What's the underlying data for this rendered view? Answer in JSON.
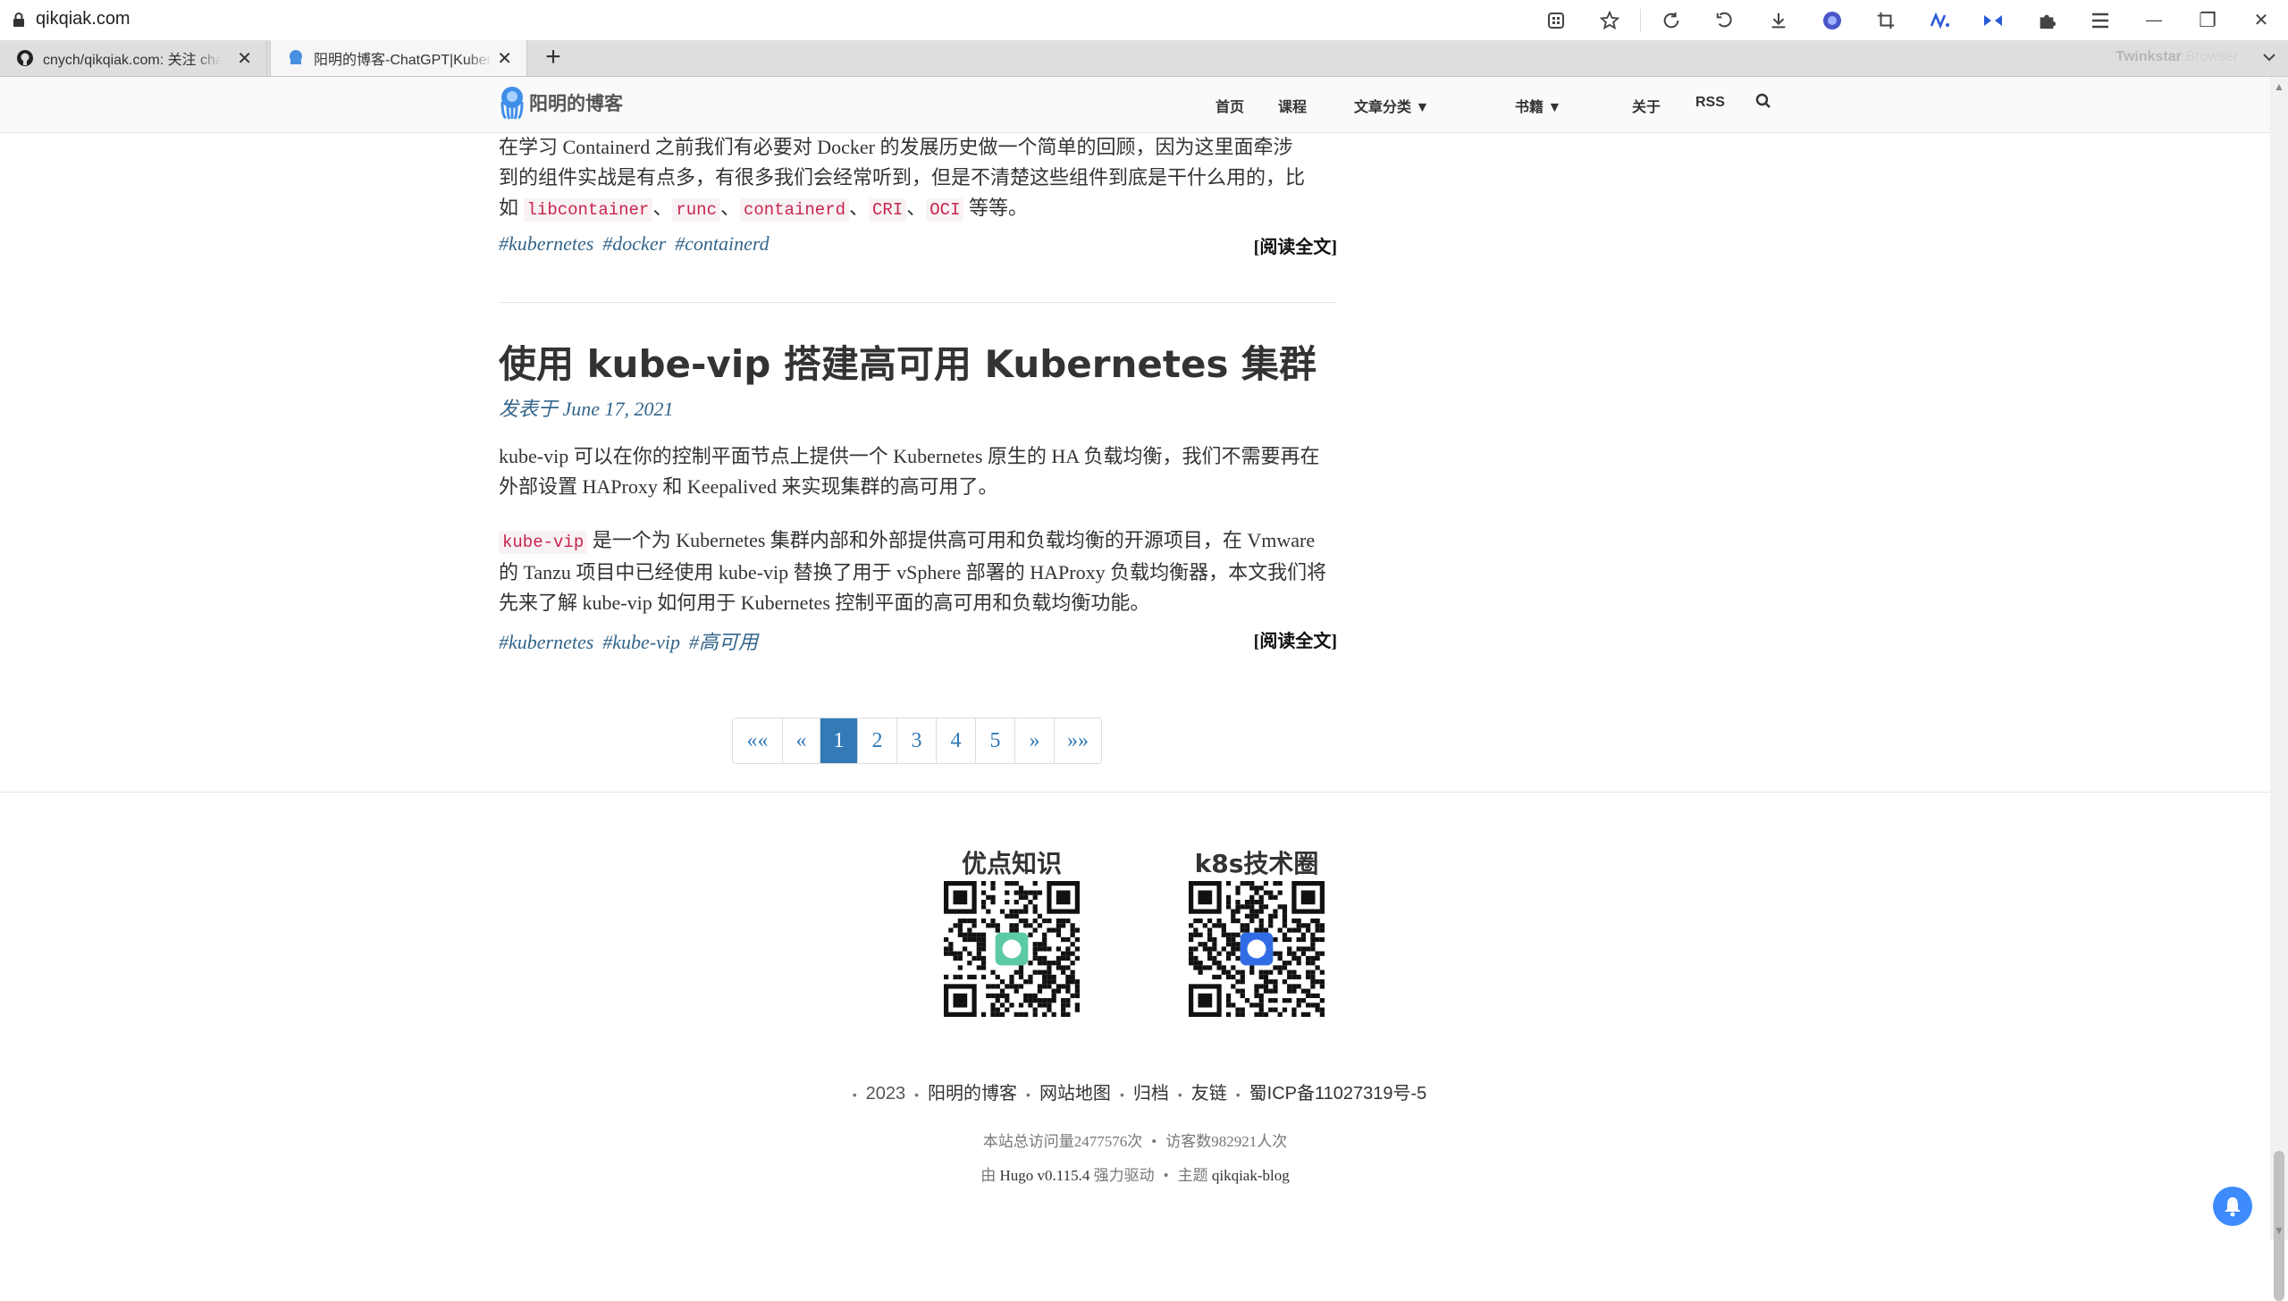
{
  "browser": {
    "url": "qikqiak.com",
    "tabs": [
      {
        "title": "cnych/qikqiak.com: 关注 cha",
        "active": false
      },
      {
        "title": "阳明的博客-ChatGPT|Kubern",
        "active": true
      }
    ],
    "new_tab_label": "+",
    "brand": {
      "bold": "Twinkstar",
      "light": " Browser"
    },
    "window_buttons": {
      "minimize": "—",
      "restore": "❐",
      "close": "✕"
    }
  },
  "site": {
    "logo_text": "阳明的博客",
    "nav": [
      "首页",
      "课程",
      "文章分类 ▼",
      "书籍 ▼",
      "关于",
      "RSS"
    ]
  },
  "post_prev": {
    "excerpt_parts": [
      "在学习 Containerd 之前我们有必要对 Docker 的发展历史做一个简单的回顾，因为这里面牵涉",
      "到的组件实战是有点多，有很多我们会经常听到，但是不清楚这些组件到底是干什么用的，比",
      "如 "
    ],
    "codes": [
      "libcontainer",
      "runc",
      "containerd",
      "CRI",
      "OCI"
    ],
    "code_sep": "、",
    "excerpt_tail": " 等等。",
    "tags": [
      "#kubernetes",
      "#docker",
      "#containerd"
    ],
    "read_more": "[阅读全文]"
  },
  "post_main": {
    "title": "使用 kube-vip 搭建高可用 Kubernetes 集群",
    "date": "发表于 June 17, 2021",
    "para1": "kube-vip 可以在你的控制平面节点上提供一个 Kubernetes 原生的 HA 负载均衡，我们不需要再在外部设置 HAProxy 和 Keepalived 来实现集群的高可用了。",
    "para2_code": "kube-vip",
    "para2": " 是一个为 Kubernetes 集群内部和外部提供高可用和负载均衡的开源项目，在 Vmware 的 Tanzu 项目中已经使用 kube-vip 替换了用于 vSphere 部署的 HAProxy 负载均衡器，本文我们将先来了解 kube-vip 如何用于 Kubernetes 控制平面的高可用和负载均衡功能。",
    "tags": [
      "#kubernetes",
      "#kube-vip",
      "#高可用"
    ],
    "read_more": "[阅读全文]"
  },
  "pagination": {
    "items": [
      "««",
      "«",
      "1",
      "2",
      "3",
      "4",
      "5",
      "»",
      "»»"
    ],
    "current": "1"
  },
  "footer": {
    "qr": [
      {
        "title": "优点知识",
        "center_color": "#5cc9a7"
      },
      {
        "title": "k8s技术圈",
        "center_color": "#326ce5"
      }
    ],
    "year": "2023",
    "links": [
      "阳明的博客",
      "网站地图",
      "归档",
      "友链",
      "蜀ICP备11027319号-5"
    ],
    "stats_pv": "本站总访问量2477576次",
    "stats_uv": "访客数982921人次",
    "powered_prefix": "由 ",
    "powered_link": "Hugo v0.115.4",
    "powered_mid": " 强力驱动",
    "theme_prefix": "主题 ",
    "theme_link": "qikqiak-blog"
  },
  "colors": {
    "accent": "#337ab7",
    "tag": "#33658a",
    "code": "#c7254e"
  }
}
